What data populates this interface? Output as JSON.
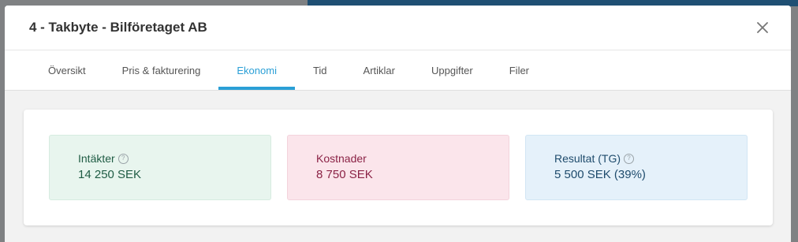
{
  "modal": {
    "title": "4 - Takbyte - Bilföretaget AB"
  },
  "tabs": [
    {
      "label": "Översikt",
      "active": false
    },
    {
      "label": "Pris & fakturering",
      "active": false
    },
    {
      "label": "Ekonomi",
      "active": true
    },
    {
      "label": "Tid",
      "active": false
    },
    {
      "label": "Artiklar",
      "active": false
    },
    {
      "label": "Uppgifter",
      "active": false
    },
    {
      "label": "Filer",
      "active": false
    }
  ],
  "economy": {
    "income": {
      "label": "Intäkter",
      "value": "14 250 SEK",
      "color": "#e8f5ee"
    },
    "costs": {
      "label": "Kostnader",
      "value": "8 750 SEK",
      "color": "#fbe5eb"
    },
    "result": {
      "label": "Resultat (TG)",
      "value": "5 500 SEK (39%)",
      "color": "#e5f1fa"
    }
  },
  "colors": {
    "accent": "#2a9fd6"
  },
  "icons": {
    "close": "close-icon",
    "help": "help-circle-icon"
  }
}
